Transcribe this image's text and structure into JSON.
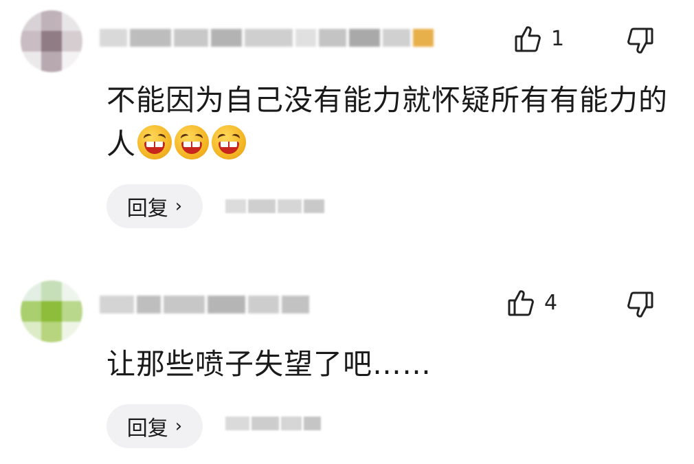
{
  "comments": [
    {
      "text": "不能因为自己没有能力就怀疑所有有能力的人",
      "like_count": "1",
      "reply_label": "回复",
      "reply_chevron": "›",
      "emoji": "laughing-emoji",
      "emoji_count": 3,
      "icons": {
        "like": "thumbs-up-icon",
        "dislike": "thumbs-down-icon"
      }
    },
    {
      "text": "让那些喷子失望了吧……",
      "like_count": "4",
      "reply_label": "回复",
      "reply_chevron": "›",
      "icons": {
        "like": "thumbs-up-icon",
        "dislike": "thumbs-down-icon"
      }
    }
  ],
  "colors": {
    "background": "#ffffff",
    "text": "#1a1a1a",
    "reply_button_bg": "#f1f1f3"
  }
}
